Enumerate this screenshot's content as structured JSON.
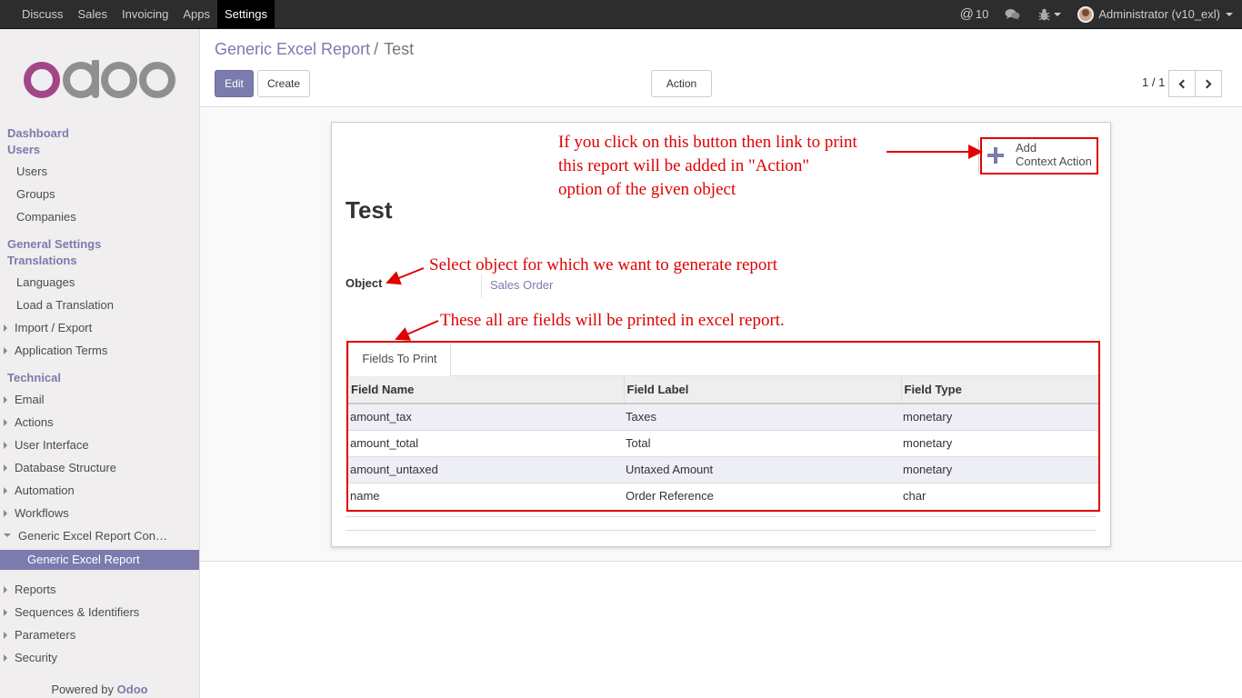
{
  "topbar": {
    "menu": [
      "Discuss",
      "Sales",
      "Invoicing",
      "Apps",
      "Settings"
    ],
    "active_menu": "Settings",
    "mentions": "10",
    "user": "Administrator (v10_exl)"
  },
  "sidebar": {
    "logo_text": "odoo",
    "sections": {
      "dashboard": "Dashboard",
      "users": "Users",
      "general_settings": "General Settings",
      "translations": "Translations",
      "technical": "Technical"
    },
    "users_items": [
      "Users",
      "Groups",
      "Companies"
    ],
    "translation_items": [
      "Languages",
      "Load a Translation",
      "Import / Export",
      "Application Terms"
    ],
    "technical_items": [
      "Email",
      "Actions",
      "User Interface",
      "Database Structure",
      "Automation",
      "Workflows",
      "Generic Excel Report Con…"
    ],
    "active_item": "Generic Excel Report",
    "technical_items_2": [
      "Reports",
      "Sequences & Identifiers",
      "Parameters",
      "Security"
    ],
    "powered_by": "Powered by",
    "powered_brand": "Odoo"
  },
  "control": {
    "breadcrumb_parent": "Generic Excel Report",
    "breadcrumb_sep": "/",
    "breadcrumb_current": "Test",
    "edit_label": "Edit",
    "create_label": "Create",
    "action_label": "Action",
    "pager": "1 / 1"
  },
  "form": {
    "title": "Test",
    "context_action_line1": "Add",
    "context_action_line2": "Context Action",
    "object_label": "Object",
    "object_value": "Sales Order",
    "tab_label": "Fields To Print",
    "columns": [
      "Field Name",
      "Field Label",
      "Field Type"
    ],
    "rows": [
      [
        "amount_tax",
        "Taxes",
        "monetary"
      ],
      [
        "amount_total",
        "Total",
        "monetary"
      ],
      [
        "amount_untaxed",
        "Untaxed Amount",
        "monetary"
      ],
      [
        "name",
        "Order Reference",
        "char"
      ]
    ]
  },
  "annotations": {
    "context_line1": "If you click on this button then link to print",
    "context_line2": "this report will be added in \"Action\"",
    "context_line3": "option of the given object",
    "object_note": "Select object for which we want to generate report",
    "fields_note": "These all are fields will be printed in excel report.",
    "color": "#e00000"
  },
  "colors": {
    "brand": "#7c7bad",
    "topbar": "#2d2d2d"
  }
}
